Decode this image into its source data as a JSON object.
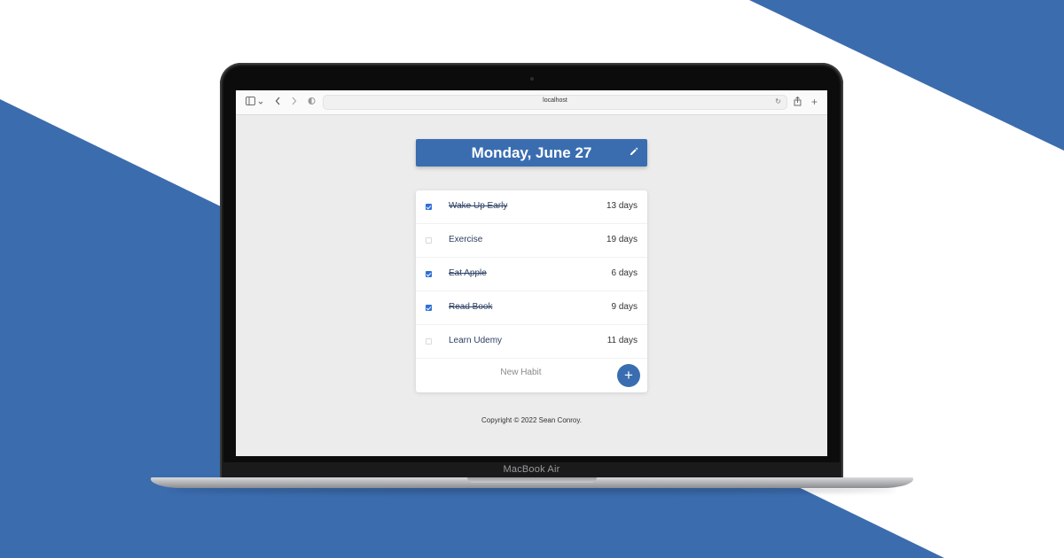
{
  "theme": {
    "accent": "#3a6db0",
    "checkbox": "#2f6fd6",
    "background_blue": "#3b6cae"
  },
  "device": {
    "model_label": "MacBook Air"
  },
  "browser": {
    "url": "localhost",
    "icons": [
      "sidebar-icon",
      "chevron-down-icon",
      "back-icon",
      "forward-icon",
      "shield-icon",
      "reload-icon",
      "share-icon",
      "new-tab-icon"
    ]
  },
  "app": {
    "date_title": "Monday, June 27",
    "habits": [
      {
        "name": "Wake Up Early",
        "streak": "13 days",
        "done": true
      },
      {
        "name": "Exercise",
        "streak": "19 days",
        "done": false
      },
      {
        "name": "Eat Apple",
        "streak": "6 days",
        "done": true
      },
      {
        "name": "Read Book",
        "streak": "9 days",
        "done": true
      },
      {
        "name": "Learn Udemy",
        "streak": "11 days",
        "done": false
      }
    ],
    "new_habit_placeholder": "New Habit",
    "add_label": "+",
    "footer": "Copyright © 2022 Sean Conroy."
  }
}
